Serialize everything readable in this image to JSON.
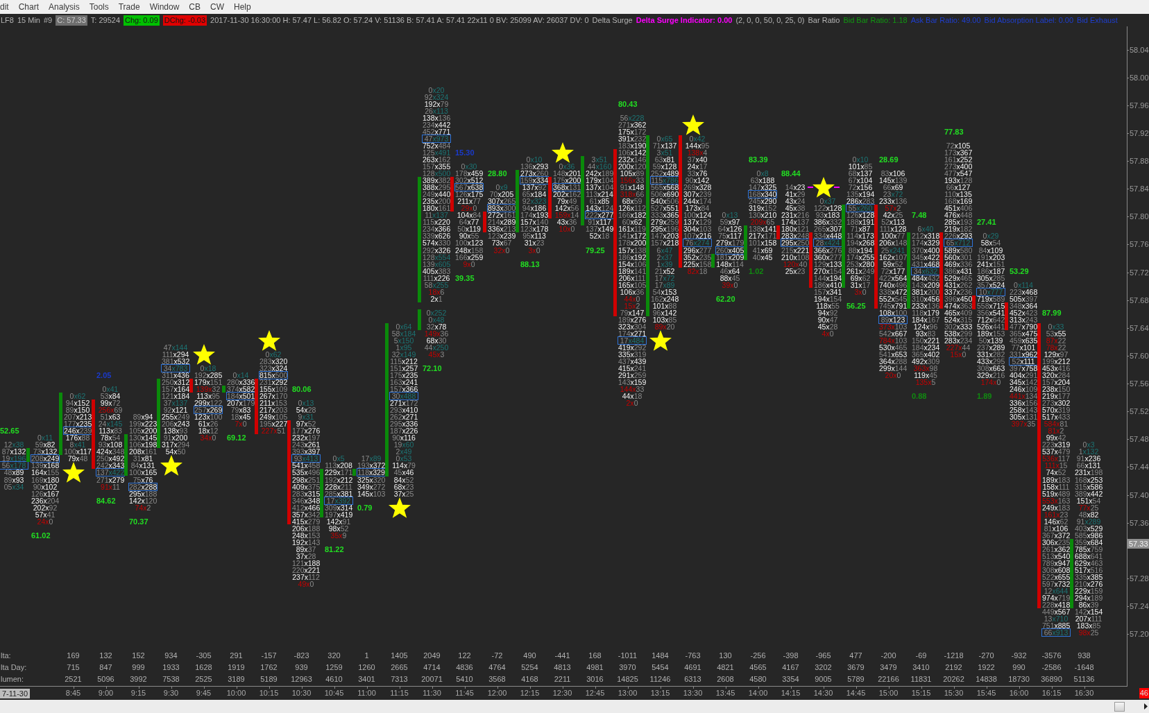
{
  "menu": [
    "dit",
    "Chart",
    "Analysis",
    "Tools",
    "Trade",
    "Window",
    "CB",
    "CW",
    "Help"
  ],
  "status_line": [
    {
      "kind": "text",
      "text": "LF8"
    },
    {
      "kind": "text",
      "text": "15 Min"
    },
    {
      "kind": "text",
      "text": "#9"
    },
    {
      "kind": "badge",
      "text": "C: 57.33",
      "color": "#6e6e6e"
    },
    {
      "kind": "text",
      "text": "T: 29524"
    },
    {
      "kind": "badge",
      "text": "Chg: 0.09",
      "color": "#00c000"
    },
    {
      "kind": "badge",
      "text": "DChg: -0.03",
      "color": "#e00000"
    },
    {
      "kind": "text",
      "text": "2017-11-30 16:30:00 H: 57.47 L: 56.82 O: 57.24 V: 51136 B: 57.41 A: 57.41 22x11 0 BV: 25099 AV: 26037 DV: 0"
    },
    {
      "kind": "text",
      "text": "Delta Surge"
    },
    {
      "kind": "bold-text",
      "text": "Delta Surge Indicator: 0.00",
      "color": "#ff00ff"
    },
    {
      "kind": "text",
      "text": "(2, 0, 0, 50, 0, 25, 0)"
    },
    {
      "kind": "text",
      "text": "Bar Ratio"
    },
    {
      "kind": "text",
      "text": "Bid Bar Ratio: 1.18",
      "color": "#119911"
    },
    {
      "kind": "text",
      "text": "Ask Bar Ratio: 49.00",
      "color": "#1f3fd0"
    },
    {
      "kind": "text",
      "text": "Bid Absorption Label: 0.00",
      "color": "#1f3fd0"
    },
    {
      "kind": "text",
      "text": "Bid Exhaust",
      "color": "#1f3fd0"
    }
  ],
  "bars": [
    {
      "top_cells": [
        "12x38",
        "87x132",
        "19x196"
      ],
      "poc_cell": "56x178",
      "bottom_cells": [
        "48x89",
        "89x93",
        "05x34"
      ],
      "label_above": {
        "text": "52.65",
        "color": "#22dd22"
      }
    },
    {
      "kind": "up",
      "top_cells": [
        "0x11",
        "59x82",
        "73x132"
      ],
      "poc_cell": "208x249",
      "bottom_cells": [
        "139x168",
        "164x155",
        "169x180",
        "90x102",
        "126x167",
        "236x204",
        "202x92",
        "57x41",
        "24x0"
      ],
      "label_below": {
        "text": "61.02",
        "color": "#22dd22"
      }
    },
    {
      "kind": "up",
      "top_cells": [
        "0x62",
        "94x152",
        "89x150",
        "207x213",
        "177x235"
      ],
      "poc_cell": "246x239",
      "bottom_cells": [
        "176x88",
        "8x41",
        "100x117",
        "79x48"
      ],
      "marker_below": {
        "kind": "star"
      }
    },
    {
      "kind": "down",
      "top_cells": [
        "0x41",
        "53x84",
        "99x72",
        "256x69",
        "51x63",
        "24x145",
        "113x83",
        "78x54",
        "93x108",
        "424x348",
        "250x492",
        "242x343"
      ],
      "poc_cell": "137x422",
      "bottom_cells": [
        "271x279",
        "91x11"
      ],
      "label_above": {
        "text": "2.05",
        "color": "#1a3acc"
      },
      "label_below": {
        "text": "84.62",
        "color": "#22dd22"
      }
    },
    {
      "kind": "up",
      "top_cells": [
        "89x94",
        "199x223",
        "105x200",
        "130x145",
        "106x198",
        "208x161",
        "31x81",
        "84x131",
        "100x165",
        "75x76"
      ],
      "poc_cell": "282x288",
      "bottom_cells": [
        "295x188",
        "142x120",
        "74x2"
      ],
      "label_below": {
        "text": "70.37",
        "color": "#22dd22"
      }
    },
    {
      "kind": "up",
      "top_cells": [
        "47x144",
        "111x294",
        "381x532"
      ],
      "poc_cell": "34x783",
      "bottom_cells": [
        "311x436",
        "250x312",
        "157x164",
        "121x184",
        "37x137",
        "92x121",
        "255x249",
        "206x243",
        "138x93",
        "91x200",
        "317x294",
        "54x50"
      ],
      "marker_below": {
        "kind": "star"
      }
    },
    {
      "kind": "down",
      "top_cells": [
        "0x18",
        "192x285",
        "179x151",
        "139x32",
        "113x95",
        "299x122"
      ],
      "poc_cell": "257x269",
      "bottom_cells": [
        "123x100",
        "61x26",
        "18x12",
        "34x0"
      ],
      "marker_above": {
        "kind": "star"
      }
    },
    {
      "kind": "up",
      "top_cells": [
        "0x14",
        "280x336",
        "374x582"
      ],
      "poc_cell": "184x501",
      "bottom_cells": [
        "207x179",
        "79x83",
        "18x45",
        "7x0"
      ],
      "label_below": {
        "text": "69.12",
        "color": "#22dd22"
      }
    },
    {
      "kind": "down",
      "top_cells": [
        "0x62",
        "283x320",
        "323x324"
      ],
      "poc_cell": "815x500",
      "bottom_cells": [
        "231x292",
        "155x109",
        "267x170",
        "211x153",
        "217x203",
        "249x105",
        "195x227",
        "227x51"
      ],
      "marker_above": {
        "kind": "star"
      }
    },
    {
      "kind": "down",
      "top_cells": [
        "0x13",
        "54x28",
        "9x31",
        "97x52",
        "177x276",
        "232x197",
        "243x261",
        "393x397"
      ],
      "poc_cell": "93x413",
      "bottom_cells": [
        "541x458",
        "535x496",
        "298x251",
        "409x375",
        "283x315",
        "346x348",
        "412x466",
        "357x342",
        "415x279",
        "206x188",
        "248x153",
        "192x143",
        "89x37",
        "37x28",
        "121x188",
        "220x221",
        "237x112",
        "49x0"
      ],
      "label_above": {
        "text": "80.06",
        "color": "#22dd22"
      }
    },
    {
      "kind": "up",
      "top_cells": [
        "0x5",
        "113x208",
        "229x171",
        "192x212",
        "228x211",
        "285x381"
      ],
      "poc_cell": "17x392",
      "bottom_cells": [
        "309x314",
        "197x419",
        "142x91",
        "98x52",
        "35x9"
      ],
      "label_below": {
        "text": "81.22",
        "color": "#22dd22"
      }
    },
    {
      "kind": "up",
      "top_cells": [
        "17x89",
        "193x372"
      ],
      "poc_cell": "118x329",
      "bottom_cells": [
        "325x320",
        "349x272",
        "145x103"
      ],
      "label_below": {
        "text": "0.79",
        "color": "#22dd22"
      }
    },
    {
      "kind": "up",
      "top_cells": [
        "0x64",
        "58x184",
        "5x150",
        "1x95",
        "32x149",
        "115x212",
        "151x257",
        "175x235",
        "163x241",
        "157x366"
      ],
      "poc_cell": "30x488",
      "bottom_cells": [
        "271x172",
        "293x410",
        "262x271",
        "295x336",
        "187x226",
        "90x116",
        "19x60",
        "2x49",
        "0x53",
        "114x79",
        "45x46",
        "84x52",
        "68x23",
        "37x25"
      ],
      "marker_below": {
        "kind": "star"
      }
    },
    {
      "kind": "up",
      "top_cells": [
        "0x20",
        "92x324",
        "192x79",
        "26x113",
        "138x136",
        "234x442",
        "452x771"
      ],
      "poc_cell": "47x973",
      "bottom_cells": [
        "752x484",
        "125x491",
        "263x162",
        "157x355",
        "128x500",
        "389x382",
        "388x295",
        "249x440",
        "235x200",
        "180x161",
        "11x137",
        "115x220",
        "234x366",
        "339x626",
        "574x330",
        "292x326",
        "128x554",
        "139x605",
        "405x383",
        "111x226",
        "58x255",
        "18x6",
        "2x1",
        "0x252",
        "0x48",
        "32x78",
        "149x36",
        "68x30",
        "44x250",
        "45x3"
      ],
      "label_below": {
        "text": "72.10",
        "color": "#22dd22"
      }
    },
    {
      "kind": "down",
      "top_cells": [
        "0x30",
        "178x459",
        "302x512"
      ],
      "poc_cell": "567x638",
      "bottom_cells": [
        "126x175",
        "211x77",
        "29x0",
        "104x84",
        "64x77",
        "50x119",
        "90x55",
        "100x123",
        "248x158",
        "166x259",
        "9x0"
      ],
      "label_above": {
        "text": "15.30",
        "color": "#1a3acc"
      },
      "label_below": {
        "text": "39.35",
        "color": "#22dd22"
      }
    },
    {
      "kind": "down",
      "top_cells": [
        "0x9",
        "70x205",
        "307x265"
      ],
      "poc_cell": "893x300",
      "bottom_cells": [
        "272x161",
        "214x289",
        "336x213",
        "123x239",
        "73x67",
        "32x0"
      ],
      "label_above": {
        "text": "28.80",
        "color": "#22dd22"
      }
    },
    {
      "kind": "up",
      "top_cells": [
        "0x10",
        "136x293",
        "273x260"
      ],
      "poc_cell": "159x334",
      "bottom_cells": [
        "137x92",
        "65x184",
        "92x323",
        "94x186",
        "174x193",
        "157x140",
        "123x178",
        "95x113",
        "31x23",
        "3x0"
      ],
      "label_below": {
        "text": "88.13",
        "color": "#22dd22"
      }
    },
    {
      "kind": "down",
      "top_cells": [
        "0x36",
        "148x201",
        "175x200"
      ],
      "poc_cell": "368x131",
      "bottom_cells": [
        "202x162",
        "79x49",
        "142x56",
        "159x14",
        "43x36",
        "10x0"
      ],
      "marker_above": {
        "kind": "star"
      }
    },
    {
      "kind": "up",
      "top_cells": [
        "3x51",
        "44x160",
        "242x189",
        "179x104",
        "137x104",
        "113x214",
        "61x85",
        "143x124"
      ],
      "poc_cell": "222x277",
      "bottom_cells": [
        "91x117",
        "137x149",
        "52x18"
      ],
      "label_below": {
        "text": "79.25",
        "color": "#22dd22"
      }
    },
    {
      "kind": "down",
      "top_cells": [
        "56x228",
        "271x362",
        "175x172",
        "391x232",
        "183x190",
        "106x142",
        "232x146",
        "200x120",
        "105x89",
        "156x33",
        "91x148",
        "318x66",
        "68x59",
        "126x112",
        "166x182",
        "60x62",
        "161x119",
        "141x172",
        "178x200",
        "157x138",
        "186x192",
        "154x106",
        "189x141",
        "206x111",
        "165x105",
        "106x36",
        "44x0",
        "15x2",
        "79x147",
        "189x276",
        "323x304",
        "174x271"
      ],
      "poc_cell": "17x484",
      "bottom_cells": [
        "419x292",
        "335x319",
        "437x439",
        "415x241",
        "291x259",
        "143x159",
        "144x33",
        "44x18",
        "2x0"
      ],
      "label_above": {
        "text": "80.43",
        "color": "#22dd22"
      }
    },
    {
      "kind": "up",
      "top_cells": [
        "0x65",
        "71x137",
        "3x51",
        "63x81",
        "59x128",
        "252x489"
      ],
      "poc_cell": "115x786",
      "bottom_cells": [
        "565x568",
        "506x690",
        "540x506",
        "527x551",
        "333x365",
        "279x259",
        "295x196",
        "147x203",
        "157x218",
        "6x47",
        "2x37",
        "1x39",
        "21x52",
        "17x72",
        "17x89",
        "54x153",
        "162x248",
        "101x88",
        "96x142",
        "103x85",
        "89x20"
      ],
      "marker_below": {
        "kind": "star"
      }
    },
    {
      "kind": "down",
      "top_cells": [
        "0x42",
        "144x95",
        "138x4",
        "37x40",
        "24x17",
        "33x76",
        "90x142",
        "269x328",
        "307x239",
        "244x174",
        "173x84",
        "100x124",
        "137x129",
        "304x103",
        "107x216"
      ],
      "poc_cell": "76x274",
      "bottom_cells": [
        "296x277",
        "352x235",
        "225x158",
        "82x18"
      ],
      "marker_above": {
        "kind": "star"
      }
    },
    {
      "kind": "up",
      "top_cells": [
        "0x13",
        "59x97",
        "64x126",
        "75x117",
        "279x179"
      ],
      "poc_cell": "260x405",
      "bottom_cells": [
        "181x209",
        "148x114",
        "46x64",
        "88x45",
        "39x0"
      ],
      "label_below": {
        "text": "62.20",
        "color": "#22dd22"
      }
    },
    {
      "kind": "up",
      "top_cells": [
        "0x8",
        "63x188",
        "147x325"
      ],
      "poc_cell": "168x340",
      "bottom_cells": [
        "245x290",
        "319x152",
        "130x210",
        "209x65",
        "138x141",
        "217x171",
        "101x158",
        "41x69",
        "40x45"
      ],
      "label_above": {
        "text": "83.39",
        "color": "#22dd22"
      },
      "label_below": {
        "text": "1.02",
        "color": "#108a10"
      }
    },
    {
      "kind": "down",
      "top_cells": [
        "14x23",
        "41x29",
        "43x24",
        "45x38",
        "231x216",
        "174x137",
        "180x121",
        "283x248"
      ],
      "poc_cell": "295x250",
      "bottom_cells": [
        "215x221",
        "210x108",
        "120x40",
        "25x23"
      ],
      "label_above": {
        "text": "88.44",
        "color": "#22dd22"
      }
    },
    {
      "kind": "down",
      "top_cells": [
        "0x37",
        "122x128",
        "93x183",
        "386x332",
        "265x307",
        "334x448"
      ],
      "poc_cell": "28x424",
      "bottom_cells": [
        "366x276",
        "360x277",
        "129x133",
        "270x154",
        "144x194",
        "186x410",
        "157x341",
        "194x154",
        "118x55",
        "94x92",
        "90x47",
        "45x28",
        "4x0"
      ],
      "marker_above": {
        "kind": "star-dashes"
      }
    },
    {
      "kind": "up",
      "top_cells": [
        "0x10",
        "101x85",
        "68x137",
        "67x104",
        "72x156",
        "135x194",
        "286x283"
      ],
      "poc_cell": "55x260",
      "bottom_cells": [
        "126x128",
        "188x191",
        "71x87",
        "114x173",
        "194x268",
        "88x194",
        "174x255",
        "253x280",
        "261x249",
        "69x62",
        "31x17",
        "3x0"
      ],
      "label_below": {
        "text": "56.25",
        "color": "#22dd22"
      }
    },
    {
      "kind": "down",
      "top_cells": [
        "83x106",
        "145x139",
        "66x69",
        "23x72",
        "233x136",
        "57x2",
        "42x25",
        "52x113",
        "111x128",
        "100x77",
        "206x148",
        "25x241",
        "162x107",
        "59x52",
        "72x177",
        "422x564",
        "740x496",
        "338x472",
        "552x545",
        "745x791",
        "108x100"
      ],
      "poc_cell": "89x123",
      "bottom_cells": [
        "373x103",
        "542x667",
        "784x103",
        "530x465",
        "541x653",
        "364x288",
        "299x144",
        "20x0"
      ],
      "label_above": {
        "text": "28.69",
        "color": "#22dd22"
      }
    },
    {
      "kind": "up",
      "top_cells": [
        "6x40",
        "212x318",
        "174x329",
        "370x400",
        "345x422",
        "431x468"
      ],
      "poc_cell": "34x632",
      "bottom_cells": [
        "484x432",
        "143x209",
        "381x200",
        "310x456",
        "233x136",
        "118x179",
        "184x167",
        "124x96",
        "93x83",
        "150x221",
        "184x234",
        "365x402",
        "492x309",
        "363x98",
        "119x45",
        "135x5"
      ],
      "label_above": {
        "text": "7.48",
        "color": "#22dd22"
      },
      "label_below": {
        "text": "0.88",
        "color": "#108a10"
      }
    },
    {
      "kind": "down",
      "top_cells": [
        "72x105",
        "173x367",
        "161x252",
        "273x400",
        "477x547",
        "193x128",
        "66x127",
        "110x135",
        "168x169",
        "451x406",
        "476x448",
        "285x193",
        "219x182",
        "226x293"
      ],
      "poc_cell": "65x712",
      "bottom_cells": [
        "589x580",
        "560x301",
        "469x336",
        "386x431",
        "529x465",
        "431x262",
        "337x236",
        "396x450",
        "474x363",
        "465x409",
        "524x315",
        "302x333",
        "538x299",
        "283x234",
        "227x44",
        "15x0"
      ],
      "label_above": {
        "text": "77.83",
        "color": "#22dd22"
      }
    },
    {
      "kind": "down",
      "top_cells": [
        "0x29",
        "58x54",
        "84x109",
        "191x203",
        "241x151",
        "186x187",
        "305x285",
        "357x524"
      ],
      "poc_cell": "10x777",
      "bottom_cells": [
        "719x589",
        "558x715",
        "356x541",
        "712x642",
        "526x441",
        "189x153",
        "50x139",
        "237x289",
        "331x282",
        "433x295",
        "308x663",
        "329x216",
        "174x0"
      ],
      "label_above": {
        "text": "27.41",
        "color": "#22dd22"
      },
      "label_below": {
        "text": "1.89",
        "color": "#108a10"
      }
    },
    {
      "kind": "down",
      "top_cells": [
        "0x114",
        "223x468",
        "505x397",
        "348x364",
        "452x423",
        "313x243",
        "477x790",
        "365x475",
        "459x635",
        "77x101",
        "331x962"
      ],
      "poc_cell": "52x111",
      "bottom_cells": [
        "397x758",
        "404x291",
        "345x142",
        "246x109",
        "441x134",
        "336x156",
        "258x143",
        "305x131",
        "397x35"
      ],
      "label_above": {
        "text": "53.29",
        "color": "#22dd22"
      }
    },
    {
      "kind": "down",
      "top_cells": [
        "0x33",
        "53x55",
        "87x22",
        "78x22",
        "129x97",
        "199x212",
        "453x416",
        "320x284",
        "157x204",
        "238x150",
        "219x177",
        "273x302",
        "570x319",
        "517x433",
        "584x81",
        "81x2",
        "99x42",
        "223x319",
        "537x479",
        "536x117",
        "111x15",
        "74x52",
        "189x183",
        "158x111",
        "519x489",
        "553x163",
        "249x183",
        "161x23",
        "146x62",
        "81x106",
        "367x372",
        "306x235",
        "261x362",
        "513x540",
        "789x947",
        "308x608",
        "522x655",
        "597x732",
        "12x644",
        "974x719",
        "228x418",
        "449x567",
        "13x710",
        "751x885"
      ],
      "poc_cell": "66x913",
      "label_above": {
        "text": "87.99",
        "color": "#22dd22"
      }
    },
    {
      "kind": "up",
      "top_cells": [
        "0x3",
        "1x132",
        "91x236",
        "66x131",
        "231x198",
        "168x253",
        "315x586",
        "389x442",
        "151x54",
        "77x25",
        "48x82",
        "91x289",
        "403x529",
        "585x986",
        "359x684",
        "785x759",
        "688x641",
        "629x463",
        "517x516",
        "335x385",
        "210x276",
        "229x159",
        "294x189",
        "86x39",
        "142x154",
        "207x111",
        "183x85",
        "98x25"
      ]
    }
  ],
  "price_axis": {
    "labels": [
      "58.04",
      "58.00",
      "57.96",
      "57.92",
      "57.88",
      "57.84",
      "57.80",
      "57.76",
      "57.72",
      "57.68",
      "57.64",
      "57.60",
      "57.56",
      "57.52",
      "57.48",
      "57.44",
      "57.40",
      "57.36",
      "57.28",
      "57.24",
      "57.20"
    ],
    "current": "57.33"
  },
  "footer": {
    "rows": [
      {
        "label": "lta:",
        "values": [
          "169",
          "132",
          "152",
          "934",
          "-305",
          "291",
          "-157",
          "-823",
          "320",
          "1",
          "1405",
          "2049",
          "122",
          "-72",
          "490",
          "-441",
          "168",
          "-1011",
          "1484",
          "-763",
          "130",
          "-256",
          "-398",
          "-965",
          "477",
          "-200",
          "-69",
          "-1218",
          "-270",
          "-932",
          "-3576",
          "938"
        ]
      },
      {
        "label": "lta Day:",
        "values": [
          "715",
          "847",
          "999",
          "1933",
          "1628",
          "1919",
          "1762",
          "939",
          "1259",
          "1260",
          "2665",
          "4714",
          "4836",
          "4764",
          "5254",
          "4813",
          "4981",
          "3970",
          "5454",
          "4691",
          "4821",
          "4565",
          "4167",
          "3202",
          "3679",
          "3479",
          "3410",
          "2192",
          "1922",
          "990",
          "-2586",
          "-1648"
        ]
      },
      {
        "label": "lumen:",
        "values": [
          "2521",
          "5096",
          "3992",
          "7538",
          "2525",
          "3189",
          "5189",
          "12963",
          "4610",
          "3401",
          "7313",
          "20071",
          "5410",
          "3568",
          "4168",
          "2211",
          "3016",
          "14825",
          "11246",
          "6313",
          "2608",
          "4580",
          "3354",
          "9005",
          "5789",
          "22166",
          "11831",
          "20262",
          "14838",
          "18730",
          "36890",
          "51136"
        ]
      }
    ],
    "date": "7-11-30",
    "times": [
      "8:45",
      "9:00",
      "9:15",
      "9:30",
      "9:45",
      "10:00",
      "10:15",
      "10:30",
      "10:45",
      "11:00",
      "11:15",
      "11:30",
      "11:45",
      "12:00",
      "12:15",
      "12:30",
      "12:45",
      "13:00",
      "13:15",
      "13:30",
      "13:45",
      "14:00",
      "14:15",
      "14:30",
      "14:45",
      "15:00",
      "15:15",
      "15:30",
      "15:45",
      "16:00",
      "16:15",
      "16:30"
    ],
    "time_marker": "46"
  }
}
